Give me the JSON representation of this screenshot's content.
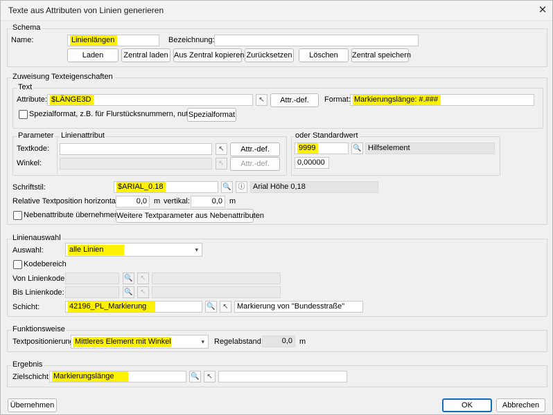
{
  "window": {
    "title": "Texte aus Attributen von Linien generieren",
    "close_label": "✕"
  },
  "schema": {
    "legend": "Schema",
    "name_label": "Name:",
    "name_value": "Linienlängen",
    "bezeichnung_label": "Bezeichnung:",
    "bezeichnung_value": "",
    "buttons": [
      "Laden",
      "Zentral laden",
      "Aus Zentral kopieren",
      "Zurücksetzen",
      "Löschen",
      "Zentral speichern"
    ]
  },
  "zuweisung": {
    "legend": "Zuweisung Texteigenschaften",
    "text": {
      "legend": "Text",
      "attribute_label": "Attribute:",
      "attribute_value": "$LÄNGE3D",
      "attr_def_label": "Attr.-def.",
      "format_label": "Format:",
      "format_value": "Markierungslänge: #.###",
      "spezial_label": "Spezialformat, z.B. für Flurstücksnummern, nutzen?",
      "spezial_button": "Spezialformat"
    },
    "parameter": {
      "legend": "Parameter",
      "linienattribut_legend": "Linienattribut",
      "textkode_label": "Textkode:",
      "winkel_label": "Winkel:",
      "attr_def_label": "Attr.-def.",
      "standard_legend": "oder Standardwert",
      "textkode_default": "9999",
      "textkode_desc": "Hilfselement",
      "winkel_default": "0,00000"
    },
    "schriftstil_label": "Schriftstil:",
    "schriftstil_value": "$ARIAL_0.18",
    "schriftstil_desc": "Arial Höhe 0,18",
    "relpos_label": "Relative Textposition  horizontal:",
    "horizontal_value": "0,0",
    "unit_m": "m",
    "vertikal_label": "vertikal:",
    "vertikal_value": "0,0",
    "neben_label": "Nebenattribute übernehmen?",
    "neben_button": "Weitere Textparameter aus Nebenattributen"
  },
  "linienauswahl": {
    "legend": "Linienauswahl",
    "auswahl_label": "Auswahl:",
    "auswahl_value": "alle Linien",
    "kodebereich_label": "Kodebereich",
    "von_label": "Von Linienkode:",
    "bis_label": "Bis Linienkode:",
    "schicht_label": "Schicht:",
    "schicht_value": "42196_PL_Markierung",
    "schicht_desc": "Markierung von \"Bundesstraße\""
  },
  "funktionsweise": {
    "legend": "Funktionsweise",
    "textpos_label": "Textpositionierung:",
    "textpos_value": "Mittleres Element mit Winkel",
    "regelabstand_label": "Regelabstand:",
    "regelabstand_value": "0,0",
    "unit_m": "m"
  },
  "ergebnis": {
    "legend": "Ergebnis",
    "zielschicht_label": "Zielschicht:",
    "zielschicht_value": "Markierungslänge",
    "zielschicht_desc": ""
  },
  "footer": {
    "uebernehmen_label": "Übernehmen",
    "ok_label": "OK",
    "abbrechen_label": "Abbrechen"
  },
  "icons": {
    "search": "🔍",
    "cursor": "↖",
    "info": "ⓘ",
    "dropdown": "▾"
  },
  "colors": {
    "highlight": "#fff200",
    "default_button_border": "#0f6cbd"
  }
}
